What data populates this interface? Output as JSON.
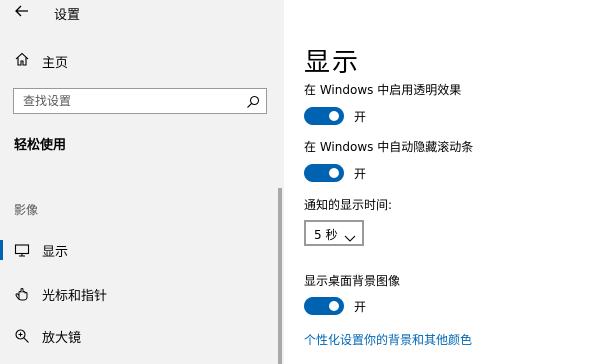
{
  "window": {
    "title": "设置"
  },
  "sidebar": {
    "home": "主页",
    "search": {
      "placeholder": "查找设置"
    },
    "group_title": "轻松使用",
    "section_vision": "影像",
    "items": [
      {
        "label": "显示",
        "icon": "display-icon",
        "selected": true
      },
      {
        "label": "光标和指针",
        "icon": "pointer-icon",
        "selected": false
      },
      {
        "label": "放大镜",
        "icon": "magnifier-icon",
        "selected": false
      }
    ]
  },
  "main": {
    "title": "显示",
    "settings": [
      {
        "label": "在 Windows 中启用透明效果",
        "state": "开"
      },
      {
        "label": "在 Windows 中自动隐藏滚动条",
        "state": "开"
      },
      {
        "label": "通知的显示时间:",
        "value": "5 秒"
      },
      {
        "label": "显示桌面背景图像",
        "state": "开"
      }
    ],
    "link": "个性化设置你的背景和其他颜色"
  },
  "colors": {
    "accent": "#0063b1",
    "link": "#0066b4",
    "sidebar_bg": "#f2f2f2"
  }
}
